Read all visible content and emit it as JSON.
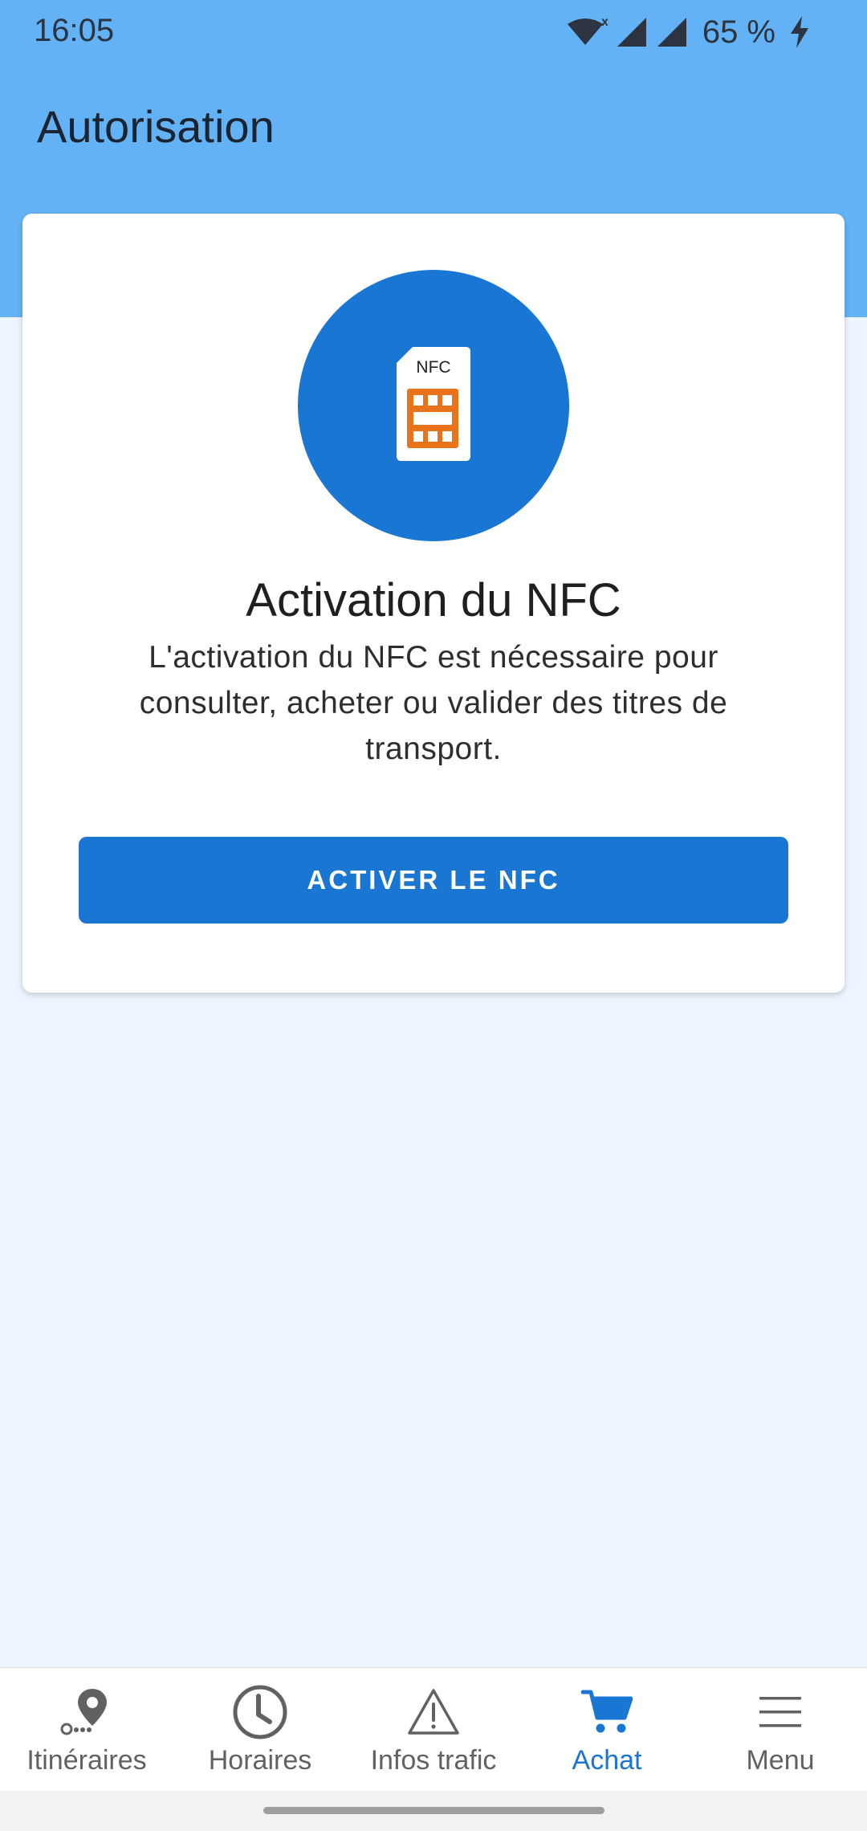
{
  "status_bar": {
    "time": "16:05",
    "battery_text": "65 %",
    "icons": [
      "wifi-icon",
      "signal-icon",
      "signal-icon",
      "charging-icon"
    ]
  },
  "header": {
    "title": "Autorisation"
  },
  "card": {
    "icon": "nfc-sim-icon",
    "icon_label": "NFC",
    "title": "Activation du NFC",
    "description": "L'activation du NFC est nécessaire pour consulter, acheter ou valider des titres de transport.",
    "button_label": "ACTIVER LE NFC"
  },
  "bottom_nav": {
    "items": [
      {
        "label": "Itinéraires",
        "icon": "route-pin-icon",
        "active": false
      },
      {
        "label": "Horaires",
        "icon": "clock-icon",
        "active": false
      },
      {
        "label": "Infos trafic",
        "icon": "warning-icon",
        "active": false
      },
      {
        "label": "Achat",
        "icon": "cart-icon",
        "active": true
      },
      {
        "label": "Menu",
        "icon": "hamburger-icon",
        "active": false
      }
    ]
  },
  "colors": {
    "header_bg": "#63b2f5",
    "accent": "#1976d2",
    "page_bg": "#eef5fe",
    "nfc_chip": "#e8731a"
  }
}
